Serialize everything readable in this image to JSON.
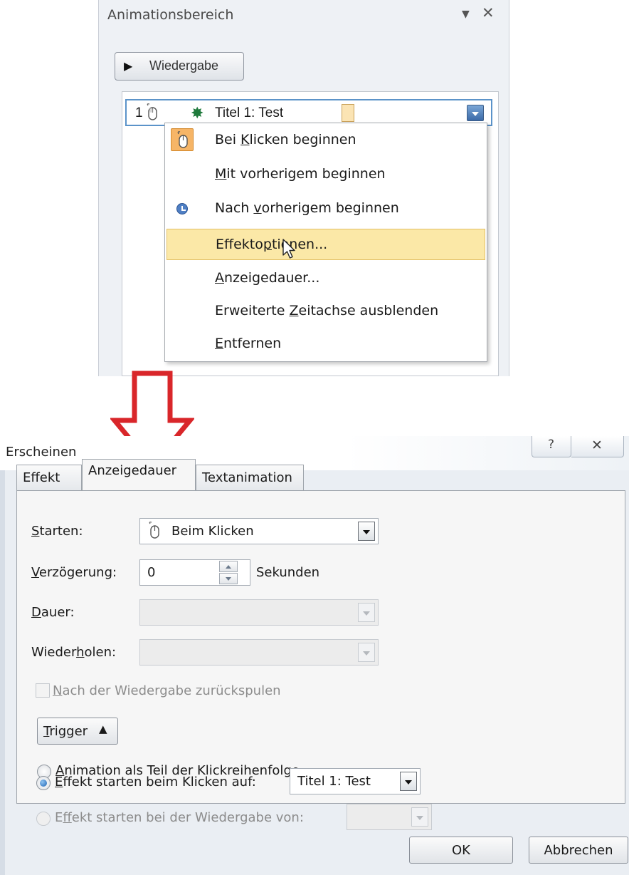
{
  "animation_pane": {
    "title": "Animationsbereich",
    "menu_icon": "dropdown-arrow-icon",
    "close_icon": "close-icon",
    "play_button": {
      "label": "Wiedergabe",
      "icon": "play-icon"
    },
    "animation_item": {
      "order": "1",
      "name": "Titel 1: Test",
      "trigger_icon": "mouse-icon",
      "effect_icon": "star-icon"
    }
  },
  "context_menu": {
    "items": [
      {
        "label_pre": "Bei ",
        "label_key": "K",
        "label_post": "licken beginnen",
        "icon": "mouse-icon"
      },
      {
        "label_pre": "",
        "label_key": "M",
        "label_post": "it vorherigem beginnen",
        "icon": ""
      },
      {
        "label_pre": "Nach ",
        "label_key": "v",
        "label_post": "orherigem beginnen",
        "icon": "clock-icon"
      },
      {
        "label_pre": "Effekto",
        "label_key": "p",
        "label_post": "tionen...",
        "icon": "",
        "highlighted": true
      },
      {
        "label_pre": "",
        "label_key": "A",
        "label_post": "nzeigedauer...",
        "icon": ""
      },
      {
        "label_pre": "Erweiterte ",
        "label_key": "Z",
        "label_post": "eitachse ausblenden",
        "icon": ""
      },
      {
        "label_pre": "",
        "label_key": "E",
        "label_post": "ntfernen",
        "icon": ""
      }
    ]
  },
  "dialog": {
    "title": "Erscheinen",
    "help_icon": "help-icon",
    "close_icon": "close-icon",
    "tabs": [
      {
        "label": "Effekt"
      },
      {
        "label": "Anzeigedauer",
        "active": true
      },
      {
        "label": "Textanimation"
      }
    ],
    "fields": {
      "start": {
        "label_key": "S",
        "label_post": "tarten:",
        "value": "Beim Klicken"
      },
      "delay": {
        "label_key": "V",
        "label_post": "erzögerung:",
        "value": "0",
        "unit": "Sekunden"
      },
      "duration": {
        "label_key": "D",
        "label_post": "auer:",
        "value": ""
      },
      "repeat": {
        "label_pre": "Wieder",
        "label_key": "h",
        "label_post": "olen:",
        "value": ""
      }
    },
    "rewind_checkbox": {
      "label_key": "N",
      "label_post": "ach der Wiedergabe zurückspulen",
      "checked": false
    },
    "trigger_button": {
      "label_key": "T",
      "label_post": "rigger",
      "icon": "collapse-up-icon"
    },
    "radios": [
      {
        "label_key": "A",
        "label_post": "nimation als Teil der Klickreihenfolge",
        "selected": false
      },
      {
        "label_key": "E",
        "label_post": "ffekt starten beim Klicken auf:",
        "selected": true,
        "value": "Titel 1: Test"
      },
      {
        "label_pre": "E",
        "label_key": "f",
        "label_post": "fekt starten bei der Wiedergabe von:",
        "selected": false,
        "value": ""
      }
    ],
    "buttons": {
      "ok": "OK",
      "cancel": "Abbrechen"
    }
  },
  "colors": {
    "highlight": "#fbe8a7",
    "arrow": "#d9262a",
    "accent": "#5b93c9"
  }
}
